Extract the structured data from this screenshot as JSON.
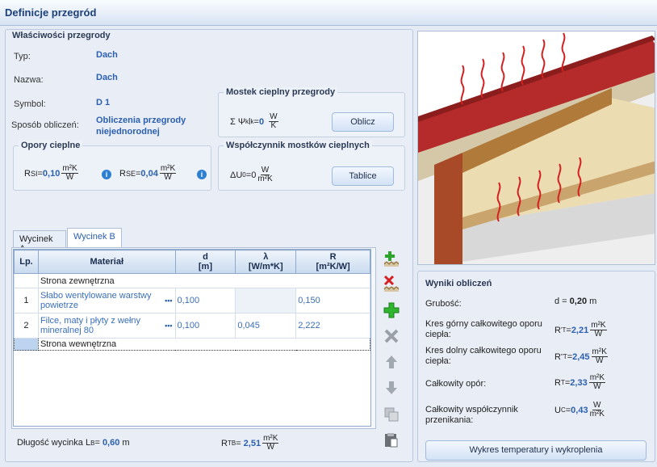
{
  "window_title": "Definicje przegród",
  "properties": {
    "title": "Właściwości przegrody",
    "typ_label": "Typ:",
    "typ_value": "Dach",
    "nazwa_label": "Nazwa:",
    "nazwa_value": "Dach",
    "symbol_label": "Symbol:",
    "symbol_value": "D 1",
    "sposob_label": "Sposób obliczeń:",
    "sposob_value": "Obliczenia przegrody niejednorodnej"
  },
  "opory": {
    "title": "Opory cieplne",
    "rsi_label": "R",
    "rsi_sub": "SI",
    "rsi_value": "0,10",
    "rse_label": "R",
    "rse_sub": "SE",
    "rse_value": "0,04",
    "unit_num": "m²K",
    "unit_den": "W"
  },
  "mostek": {
    "title": "Mostek cieplny przegrody",
    "formula": "Σ Ψ",
    "formula_sub": "k",
    "formula_l": "l",
    "formula_lsub": "k",
    "value": "0",
    "unit_num": "W",
    "unit_den": "K",
    "button": "Oblicz"
  },
  "wspolczynnik": {
    "title": "Współczynnik mostków cieplnych",
    "label": "ΔU",
    "sub": "0",
    "value": "0",
    "unit_num": "W",
    "unit_den": "m²K",
    "button": "Tablice"
  },
  "tabs": [
    {
      "label": "Wycinek A",
      "active": false
    },
    {
      "label": "Wycinek B",
      "active": true
    }
  ],
  "table": {
    "headers": {
      "lp": "Lp.",
      "material": "Materiał",
      "d_name": "d",
      "d_unit": "[m]",
      "lambda_name": "λ",
      "lambda_unit": "[W/m*K]",
      "r_name": "R",
      "r_unit": "[m²K/W]"
    },
    "outer": "Strona zewnętrzna",
    "rows": [
      {
        "lp": "1",
        "material": "Słabo wentylowane warstwy powietrze",
        "d": "0,100",
        "lambda": "",
        "r": "0,150"
      },
      {
        "lp": "2",
        "material": "Filce, maty i płyty z wełny mineralnej 80",
        "d": "0,100",
        "lambda": "0,045",
        "r": "2,222"
      }
    ],
    "inner": "Strona wewnętrzna",
    "dots": "•••"
  },
  "footer": {
    "len_label": "Długość wycinka L",
    "len_sub": "B",
    "len_eq": "=",
    "len_value": "0,60",
    "len_unit": "m",
    "rtb_label": "R",
    "rtb_sub": "TB",
    "rtb_value": "2,51",
    "unit_num": "m²K",
    "unit_den": "W"
  },
  "results": {
    "title": "Wyniki obliczeń",
    "grubosc_label": "Grubość:",
    "grubosc_pre": "d =",
    "grubosc_value": "0,20",
    "grubosc_unit": "m",
    "gorny_label": "Kres górny całkowitego oporu ciepła:",
    "gorny_sym": "R",
    "gorny_sup": "'",
    "gorny_sub": "T",
    "gorny_value": "2,21",
    "dolny_label": "Kres dolny całkowitego oporu ciepła:",
    "dolny_sym": "R",
    "dolny_sup": "\"",
    "dolny_sub": "T",
    "dolny_value": "2,45",
    "opor_label": "Całkowity opór:",
    "opor_sym": "R",
    "opor_sub": "T",
    "opor_value": "2,33",
    "u_label": "Całkowity współczynnik przenikania:",
    "u_sym": "U",
    "u_sub": "C",
    "u_value": "0,43",
    "unit_r_num": "m²K",
    "unit_r_den": "W",
    "unit_u_num": "W",
    "unit_u_den": "m²K",
    "button": "Wykres temperatury i wykroplenia"
  },
  "colors": {
    "accent": "#2b5fae",
    "title": "#1b3f78",
    "roof": "#b5212a"
  }
}
